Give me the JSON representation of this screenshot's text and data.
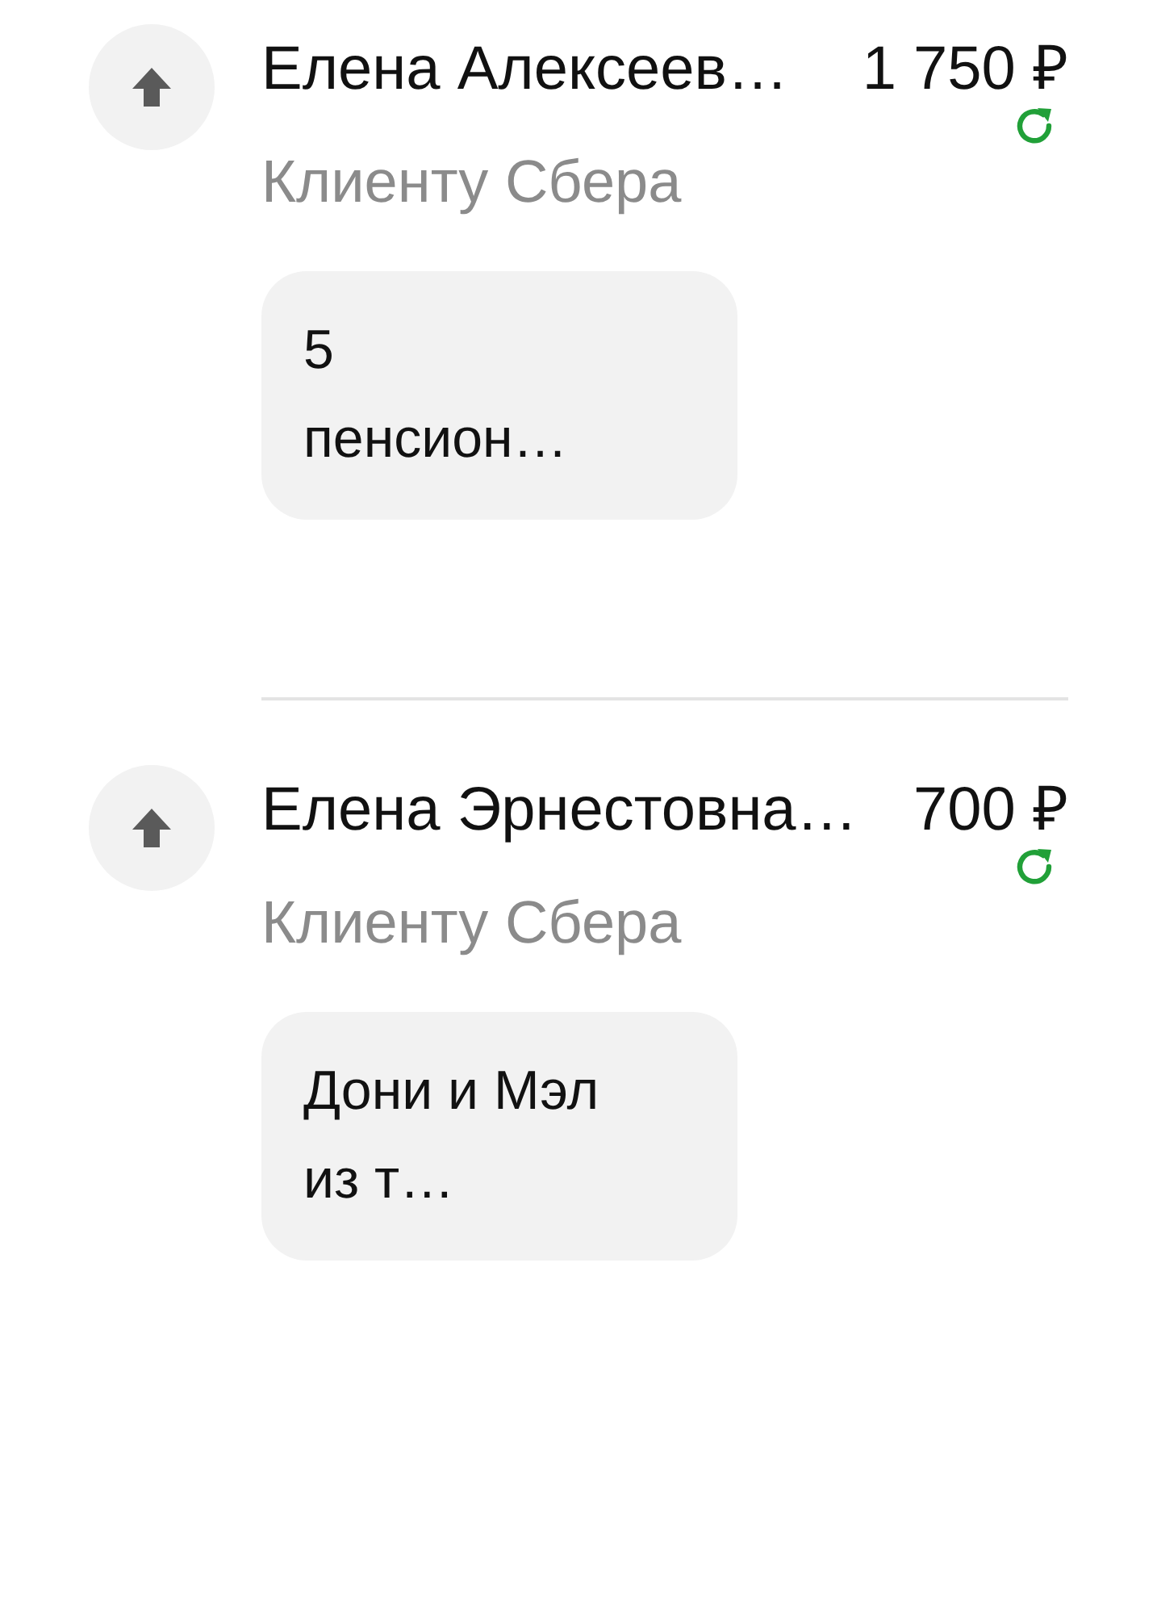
{
  "transactions": [
    {
      "name": "Елена Алексеев…",
      "subtitle": "Клиенту Сбера",
      "amount": "1 750 ₽",
      "recurring": true,
      "message": "5 пенсион…"
    },
    {
      "name": "Елена Эрнестовна…",
      "subtitle": "Клиенту Сбера",
      "amount": "700 ₽",
      "recurring": true,
      "message": "Дони и Мэл из т…"
    }
  ]
}
